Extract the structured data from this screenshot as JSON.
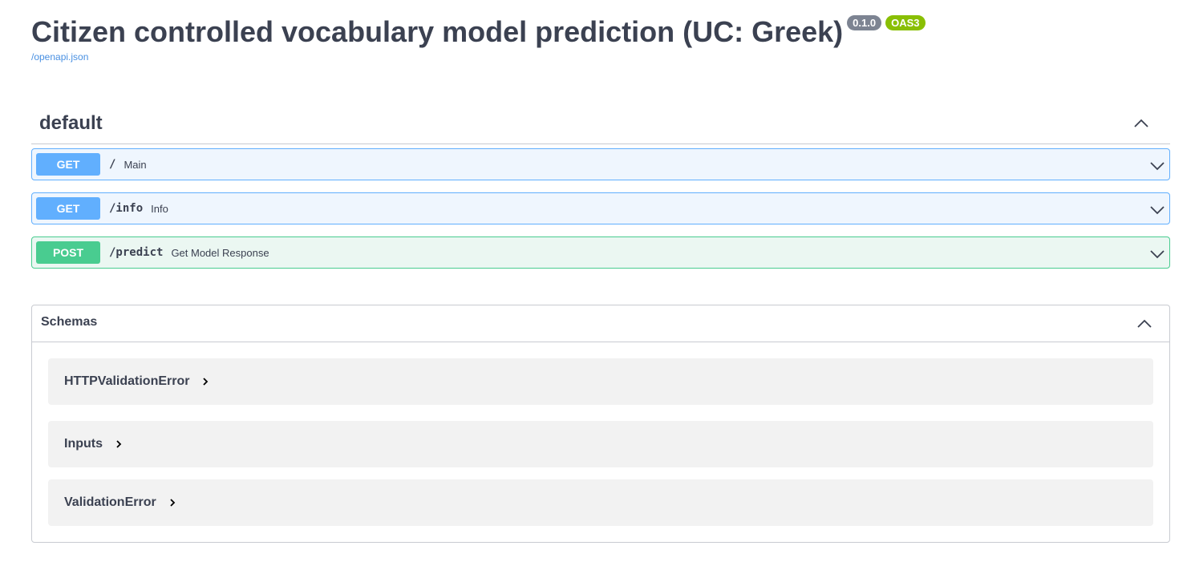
{
  "header": {
    "title": "Citizen controlled vocabulary model prediction (UC: Greek)",
    "version": "0.1.0",
    "oas": "OAS3",
    "spec_link": "/openapi.json"
  },
  "tag": {
    "name": "default"
  },
  "operations": [
    {
      "method": "GET",
      "path": "/",
      "summary": "Main"
    },
    {
      "method": "GET",
      "path": "/info",
      "summary": "Info"
    },
    {
      "method": "POST",
      "path": "/predict",
      "summary": "Get Model Response"
    }
  ],
  "schemas": {
    "title": "Schemas",
    "models": [
      "HTTPValidationError",
      "Inputs",
      "ValidationError"
    ]
  },
  "colors": {
    "get": "#61affe",
    "post": "#49cc90",
    "version_badge": "#7d8492",
    "oas_badge": "#89bf04",
    "link": "#4990e2"
  }
}
